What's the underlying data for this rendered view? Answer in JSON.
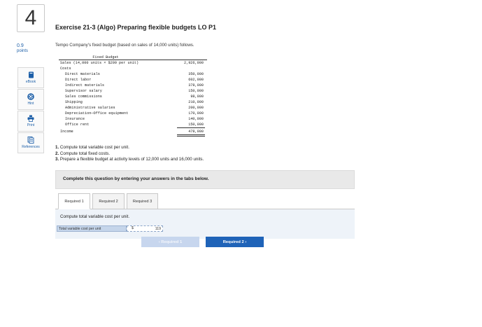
{
  "question": {
    "number": "4",
    "points_value": "0.9",
    "points_label": "points"
  },
  "tools": [
    {
      "label": "eBook",
      "icon": "book-icon"
    },
    {
      "label": "Hint",
      "icon": "lifebuoy-icon"
    },
    {
      "label": "Print",
      "icon": "printer-icon"
    },
    {
      "label": "References",
      "icon": "documents-icon"
    }
  ],
  "exercise": {
    "title": "Exercise 21-3 (Algo) Preparing flexible budgets LO P1",
    "intro": "Tempo Company's fixed budget (based on sales of 14,000 units) follows."
  },
  "budget": {
    "header": "Fixed Budget",
    "sales_label": "Sales (14,000 units × $209 per unit)",
    "sales_value": "2,926,000",
    "costs_label": "Costs",
    "cost_items": [
      {
        "label": "Direct materials",
        "value": "350,000"
      },
      {
        "label": "Direct labor",
        "value": "602,000"
      },
      {
        "label": "Indirect materials",
        "value": "378,000"
      },
      {
        "label": "Supervisor salary",
        "value": "150,000"
      },
      {
        "label": "Sales commissions",
        "value": "98,000"
      },
      {
        "label": "Shipping",
        "value": "210,000"
      },
      {
        "label": "Administrative salaries",
        "value": "200,000"
      },
      {
        "label": "Depreciation—Office equipment",
        "value": "170,000"
      },
      {
        "label": "Insurance",
        "value": "140,000"
      },
      {
        "label": "Office rent",
        "value": "150,000"
      }
    ],
    "income_label": "Income",
    "income_value": "478,000"
  },
  "requirements": [
    {
      "num": "1.",
      "text": " Compute total variable cost per unit."
    },
    {
      "num": "2.",
      "text": " Compute total fixed costs."
    },
    {
      "num": "3.",
      "text": " Prepare a flexible budget at activity levels of 12,000 units and 16,000 units."
    }
  ],
  "panel": {
    "instruction": "Complete this question by entering your answers in the tabs below."
  },
  "tabs": [
    "Required 1",
    "Required 2",
    "Required 3"
  ],
  "active_tab": "Required 1",
  "tab_content": {
    "instruction": "Compute total variable cost per unit.",
    "answer_label": "Total variable cost per unit",
    "currency": "$",
    "answer_value": "119"
  },
  "nav": {
    "prev_label": "‹  Required 1",
    "next_label": "Required 2  ›"
  },
  "colors": {
    "accent": "#1f63b8",
    "link": "#1d5fa8",
    "panel_bg": "#e9e9e9",
    "answer_label_bg": "#c5d5ea"
  }
}
